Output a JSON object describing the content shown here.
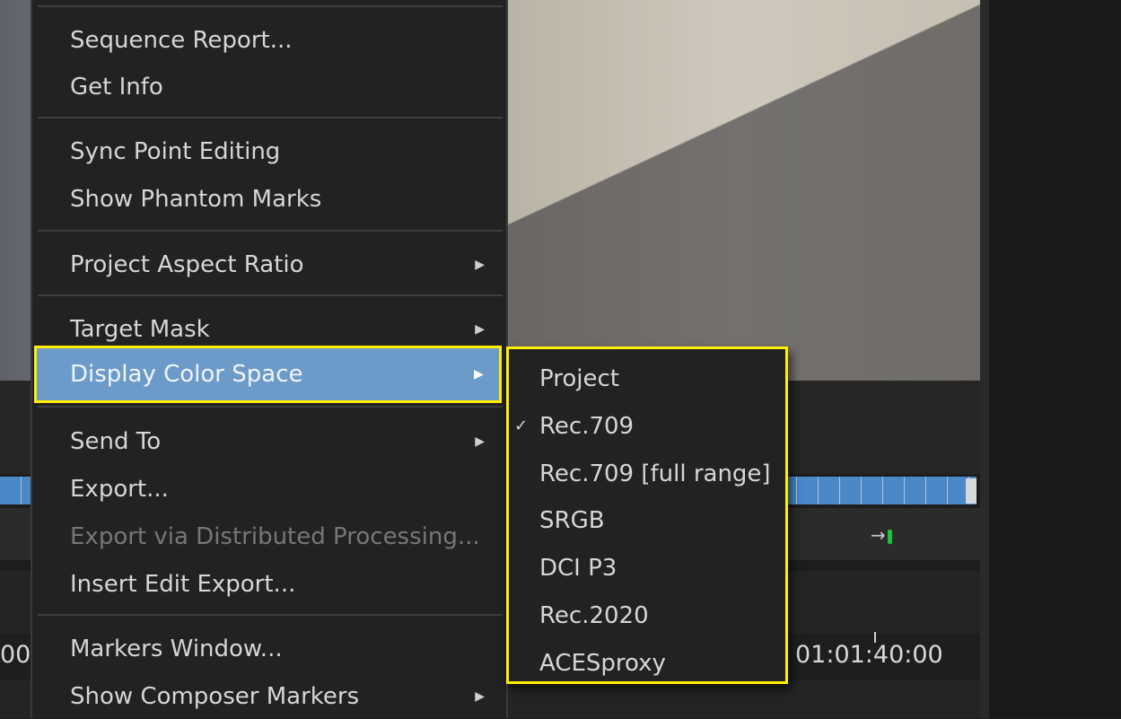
{
  "menu": {
    "items": [
      {
        "label": "Sequence Report...",
        "submenu": false
      },
      {
        "label": "Get Info",
        "submenu": false
      },
      {
        "label": "Sync Point Editing",
        "submenu": false
      },
      {
        "label": "Show Phantom Marks",
        "submenu": false
      },
      {
        "label": "Project Aspect Ratio",
        "submenu": true
      },
      {
        "label": "Target Mask",
        "submenu": true
      },
      {
        "label": "Display Color Space",
        "submenu": true,
        "highlighted": true
      },
      {
        "label": "Send To",
        "submenu": true
      },
      {
        "label": "Export...",
        "submenu": false
      },
      {
        "label": "Export via Distributed Processing...",
        "submenu": false,
        "disabled": true
      },
      {
        "label": "Insert Edit Export...",
        "submenu": false
      },
      {
        "label": "Markers Window...",
        "submenu": false
      },
      {
        "label": "Show Composer Markers",
        "submenu": true
      }
    ],
    "arrow_glyph": "▶"
  },
  "submenu": {
    "items": [
      {
        "label": "Project",
        "checked": false
      },
      {
        "label": "Rec.709",
        "checked": true
      },
      {
        "label": "Rec.709 [full range]",
        "checked": false
      },
      {
        "label": "SRGB",
        "checked": false
      },
      {
        "label": "DCI P3",
        "checked": false
      },
      {
        "label": "Rec.2020",
        "checked": false
      },
      {
        "label": "ACESproxy",
        "checked": false
      }
    ],
    "check_glyph": "✓"
  },
  "timeline": {
    "timecode_left": "00",
    "timecode_right": "01:01:40:00"
  },
  "toolbar": {
    "icon_glyph": "→"
  },
  "colors": {
    "highlight_outline": "#ffee00",
    "menu_highlight": "#6c9bc9",
    "menu_background": "#222222"
  }
}
